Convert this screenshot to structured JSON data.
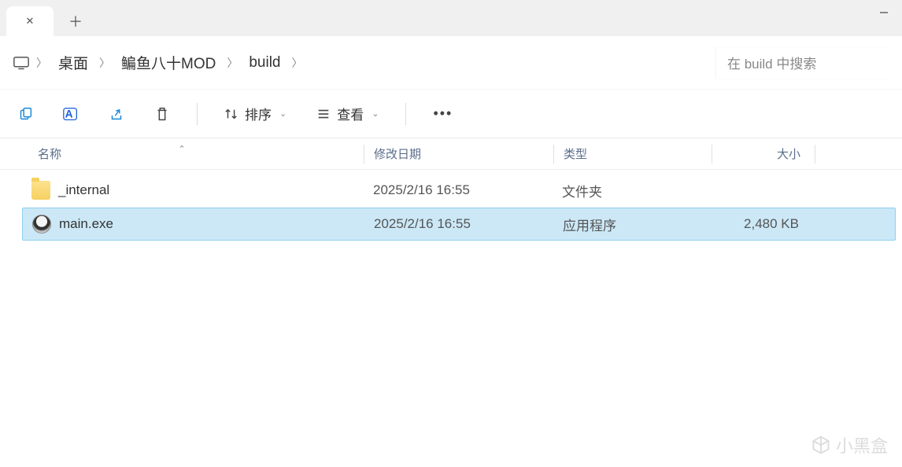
{
  "breadcrumb": {
    "items": [
      "桌面",
      "鳊鱼八十MOD",
      "build"
    ]
  },
  "search": {
    "placeholder": "在 build 中搜索"
  },
  "toolbar": {
    "sort_label": "排序",
    "view_label": "查看"
  },
  "columns": {
    "name": "名称",
    "date": "修改日期",
    "type": "类型",
    "size": "大小"
  },
  "files": [
    {
      "name": "_internal",
      "date": "2025/2/16 16:55",
      "type": "文件夹",
      "size": "",
      "icon": "folder",
      "selected": false
    },
    {
      "name": "main.exe",
      "date": "2025/2/16 16:55",
      "type": "应用程序",
      "size": "2,480 KB",
      "icon": "exe",
      "selected": true
    }
  ],
  "watermark": {
    "text": "小黑盒"
  }
}
